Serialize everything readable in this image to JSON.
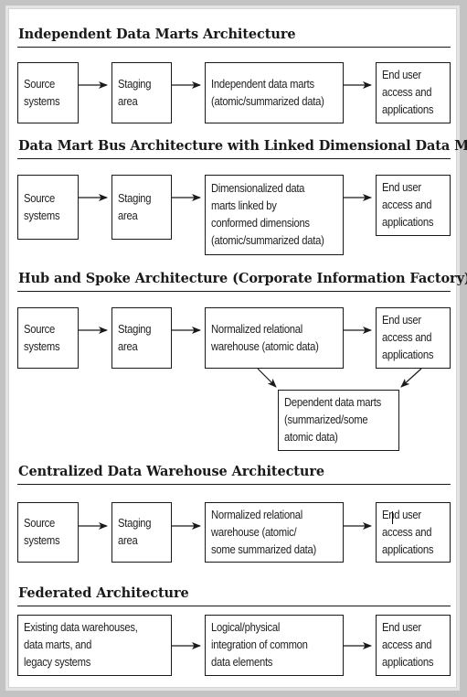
{
  "sections": [
    {
      "title": "Independent Data Marts Architecture",
      "boxes": [
        {
          "id": "source",
          "label": "Source\nsystems"
        },
        {
          "id": "staging",
          "label": "Staging\narea"
        },
        {
          "id": "marts",
          "label": "Independent data marts\n(atomic/summarized data)"
        },
        {
          "id": "enduser",
          "label": "End user\naccess and\napplications"
        }
      ],
      "flows": [
        [
          "source",
          "staging"
        ],
        [
          "staging",
          "marts"
        ],
        [
          "marts",
          "enduser"
        ]
      ]
    },
    {
      "title": "Data Mart Bus Architecture with Linked Dimensional Data Marts",
      "boxes": [
        {
          "id": "source",
          "label": "Source\nsystems"
        },
        {
          "id": "staging",
          "label": "Staging\narea"
        },
        {
          "id": "dimmarts",
          "label": "Dimensionalized data\nmarts linked by\nconformed dimensions\n(atomic/summarized data)"
        },
        {
          "id": "enduser",
          "label": "End user\naccess and\napplications"
        }
      ],
      "flows": [
        [
          "source",
          "staging"
        ],
        [
          "staging",
          "dimmarts"
        ],
        [
          "dimmarts",
          "enduser"
        ]
      ]
    },
    {
      "title": "Hub and Spoke Architecture (Corporate Information Factory)",
      "boxes": [
        {
          "id": "source",
          "label": "Source\nsystems"
        },
        {
          "id": "staging",
          "label": "Staging\narea"
        },
        {
          "id": "warehouse",
          "label": "Normalized relational\nwarehouse (atomic data)"
        },
        {
          "id": "enduser",
          "label": "End user\naccess and\napplications"
        },
        {
          "id": "depmarts",
          "label": "Dependent data marts\n(summarized/some\natomic data)"
        }
      ],
      "flows": [
        [
          "source",
          "staging"
        ],
        [
          "staging",
          "warehouse"
        ],
        [
          "warehouse",
          "enduser"
        ],
        [
          "warehouse",
          "depmarts"
        ],
        [
          "enduser",
          "depmarts"
        ]
      ]
    },
    {
      "title": "Centralized Data Warehouse Architecture",
      "boxes": [
        {
          "id": "source",
          "label": "Source\nsystems"
        },
        {
          "id": "staging",
          "label": "Staging\narea"
        },
        {
          "id": "warehouse",
          "label": "Normalized relational\nwarehouse (atomic/\nsome summarized data)"
        },
        {
          "id": "enduser",
          "label": "End user\naccess and\napplications"
        }
      ],
      "flows": [
        [
          "source",
          "staging"
        ],
        [
          "staging",
          "warehouse"
        ],
        [
          "warehouse",
          "enduser"
        ]
      ]
    },
    {
      "title": "Federated Architecture",
      "boxes": [
        {
          "id": "existing",
          "label": "Existing data warehouses,\ndata marts, and\nlegacy systems"
        },
        {
          "id": "integration",
          "label": "Logical/physical\nintegration of common\ndata elements"
        },
        {
          "id": "enduser",
          "label": "End user\naccess and\napplications"
        }
      ],
      "flows": [
        [
          "existing",
          "integration"
        ],
        [
          "integration",
          "enduser"
        ]
      ]
    }
  ],
  "colors": {
    "line": "#1a1a1a",
    "frame": "#c3c3c3",
    "page": "#ffffff"
  }
}
